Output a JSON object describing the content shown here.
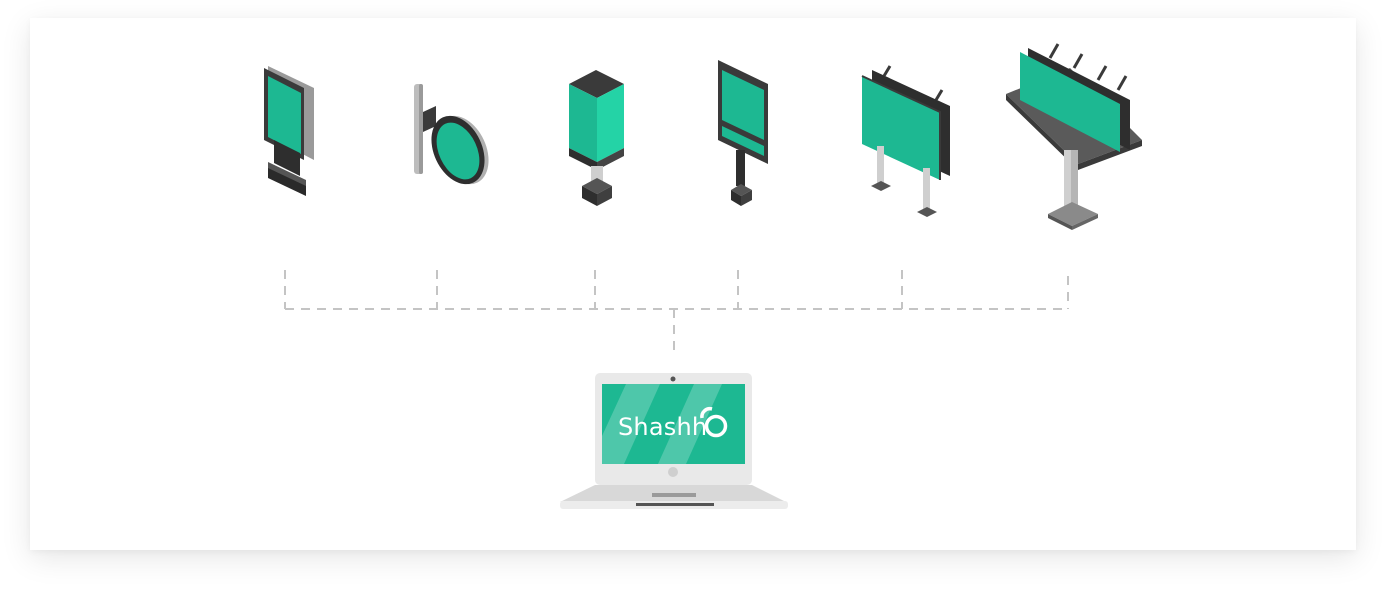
{
  "diagram": {
    "device_types": [
      {
        "name": "vertical-lightbox"
      },
      {
        "name": "round-blade-sign"
      },
      {
        "name": "pillar-kiosk"
      },
      {
        "name": "pole-mounted-screen"
      },
      {
        "name": "two-leg-billboard"
      },
      {
        "name": "tower-billboard"
      }
    ],
    "connector_style": "dashed",
    "hub": "laptop"
  },
  "laptop": {
    "brand_text": "Shashh",
    "logo_icon": "ring-o-icon"
  },
  "colors": {
    "accent": "#1db892",
    "accent_light": "#24d3a6",
    "dark": "#3a3a3a",
    "connector": "#c4c4c4",
    "laptop_body": "#e9e9e9"
  }
}
